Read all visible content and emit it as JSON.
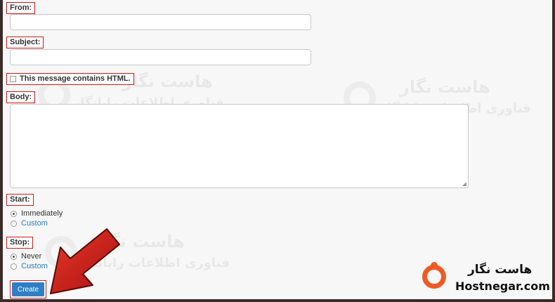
{
  "form": {
    "from_label": "From:",
    "subject_label": "Subject:",
    "html_checkbox_label": "This message contains HTML.",
    "body_label": "Body:",
    "start_label": "Start:",
    "start_options": [
      "Immediately",
      "Custom"
    ],
    "stop_label": "Stop:",
    "stop_options": [
      "Never",
      "Custom"
    ],
    "create_label": "Create"
  },
  "watermark": {
    "fa_title": "هاست نگار",
    "fa_subtitle": "فناوری اطلاعات رایانگار"
  },
  "brand": {
    "fa_name": "هاست نگار",
    "en_name": "Hostnegar.com"
  },
  "colors": {
    "accent": "#2f7fc6",
    "highlight_border": "#d01a1a",
    "arrow": "#d3201e",
    "logo": "#f05a22"
  }
}
